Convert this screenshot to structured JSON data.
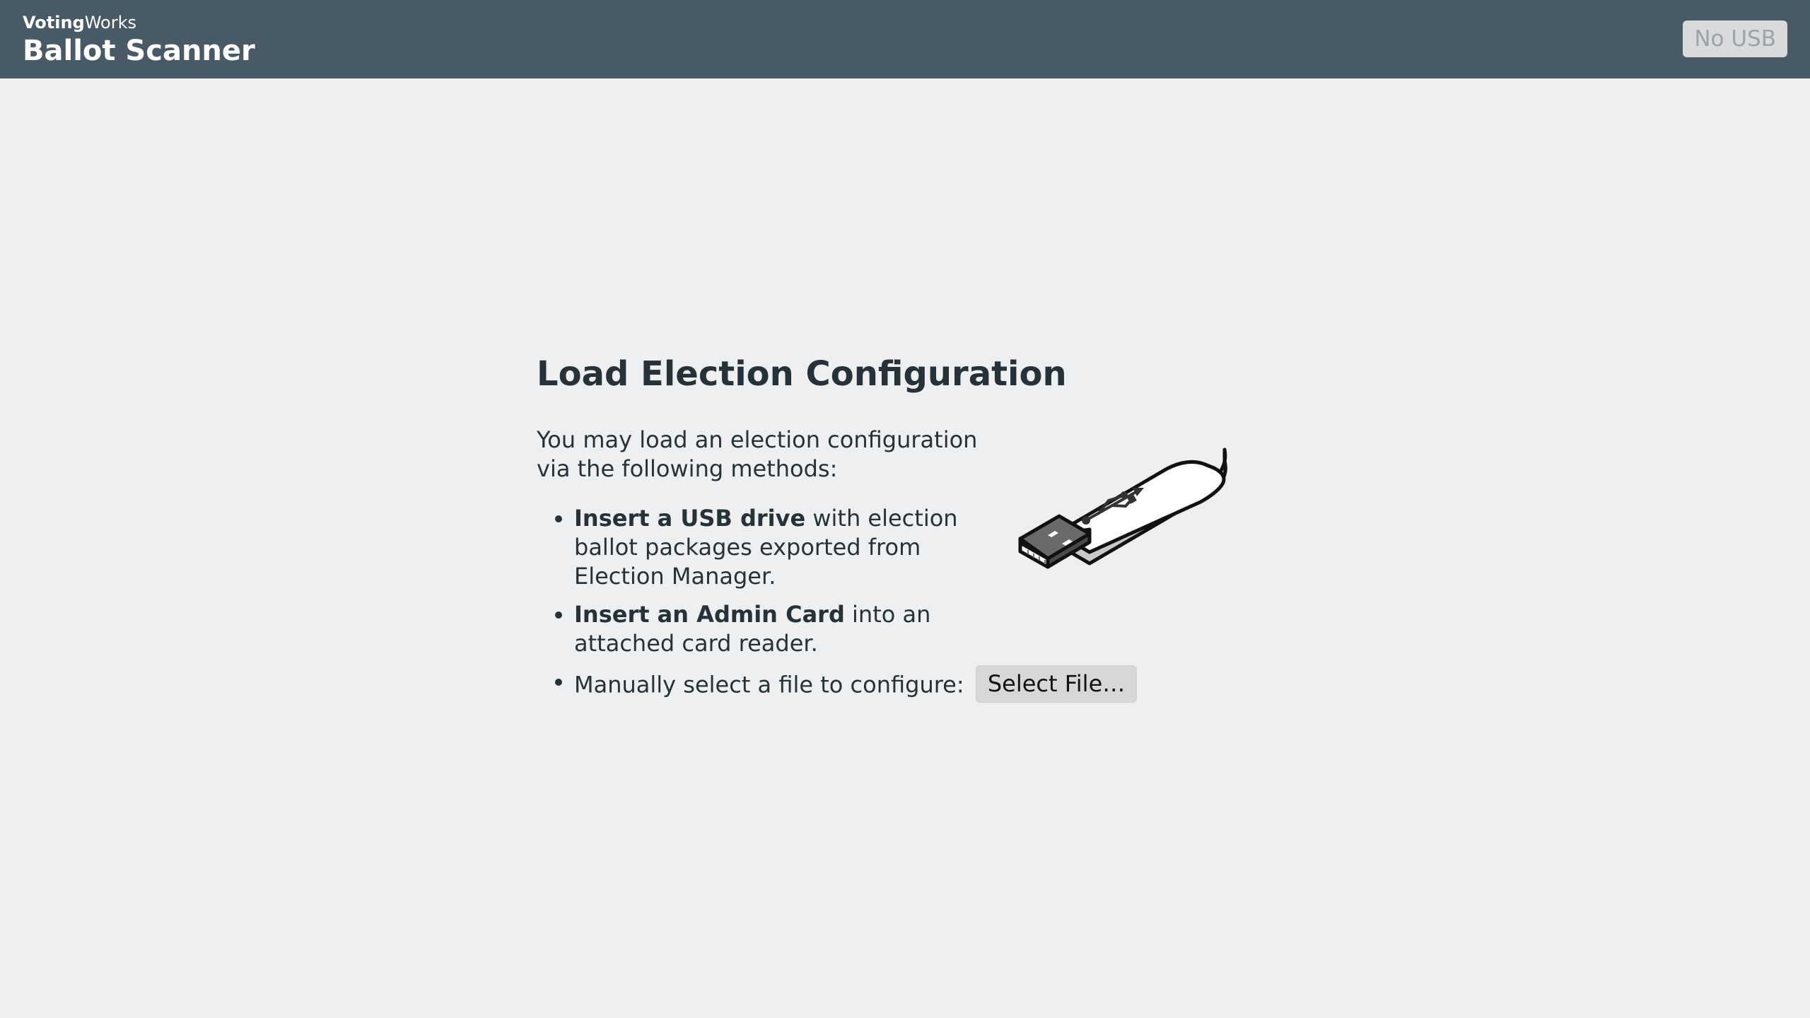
{
  "header": {
    "org_bold": "Voting",
    "org_light": "Works",
    "app_name": "Ballot Scanner",
    "usb_status": "No USB"
  },
  "main": {
    "title": "Load Election Configuration",
    "intro": "You may load an election configuration via the following methods:",
    "methods": [
      {
        "bold": "Insert a USB drive",
        "rest": " with election ballot packages exported from Election Manager."
      },
      {
        "bold": "Insert an Admin Card",
        "rest": " into an attached card reader."
      },
      {
        "text": "Manually select a file to configure:",
        "button_label": "Select File…"
      }
    ]
  },
  "icons": {
    "usb_drive": "usb-drive-icon",
    "usb_symbol": "usb-symbol-icon"
  },
  "colors": {
    "header_bg": "#475a66",
    "page_bg": "#eeeff1",
    "text": "#263238",
    "button_bg": "#d5d7d9",
    "usb_status_text": "#9ea3a8"
  }
}
